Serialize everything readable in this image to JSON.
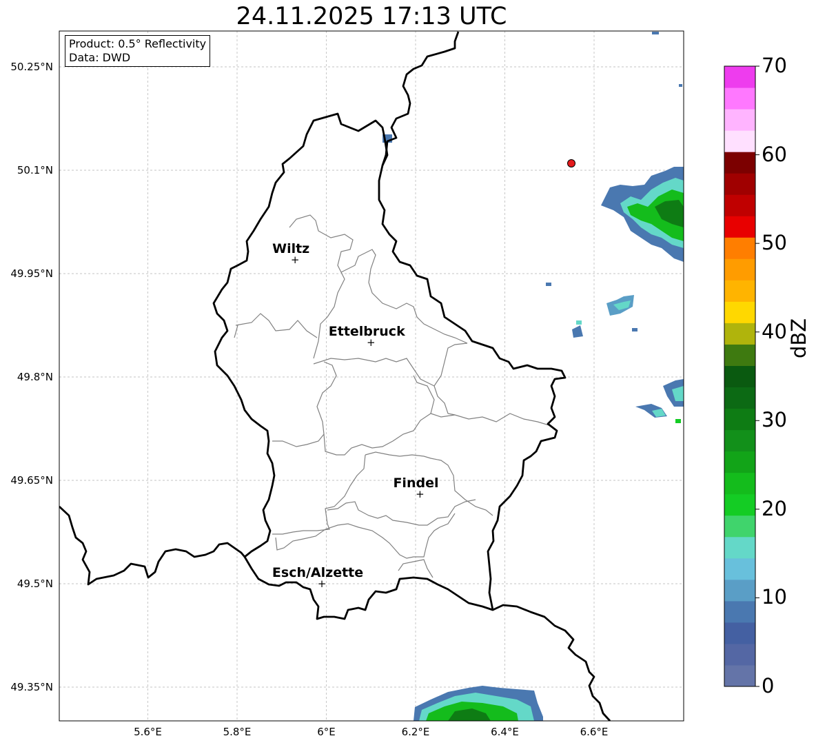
{
  "title": "24.11.2025 17:13 UTC",
  "info": {
    "product": "Product: 0.5° Reflectivity",
    "data_source": "Data: DWD"
  },
  "map": {
    "lon_range": [
      5.4,
      6.8
    ],
    "lat_range": [
      49.3,
      50.3
    ],
    "lon_ticks": [
      "5.6°E",
      "5.8°E",
      "6°E",
      "6.2°E",
      "6.4°E",
      "6.6°E"
    ],
    "lat_ticks": [
      "50.25°N",
      "50.1°N",
      "49.95°N",
      "49.8°N",
      "49.65°N",
      "49.5°N",
      "49.35°N"
    ],
    "gridlines": true,
    "cities": [
      {
        "name": "Wiltz",
        "lon": 5.93,
        "lat": 49.97
      },
      {
        "name": "Ettelbruck",
        "lon": 6.1,
        "lat": 49.85
      },
      {
        "name": "Findel",
        "lon": 6.21,
        "lat": 49.63
      },
      {
        "name": "Esch/Alzette",
        "lon": 5.99,
        "lat": 49.5
      }
    ],
    "radar_site_color": "#e41a1c"
  },
  "colorbar": {
    "label": "dBZ",
    "min": 0,
    "max": 70,
    "tick_labels": [
      "70",
      "60",
      "50",
      "40",
      "30",
      "20",
      "10",
      "0"
    ],
    "colors": [
      "#6474a8",
      "#5467a4",
      "#4460a2",
      "#4a78b0",
      "#5a9ec6",
      "#68c0dc",
      "#64d8c8",
      "#40d46c",
      "#14cc24",
      "#14bc1c",
      "#12a418",
      "#12901a",
      "#0e7c14",
      "#0c6a14",
      "#0a5a10",
      "#3e7a10",
      "#b0b40c",
      "#ffd800",
      "#ffb400",
      "#ff9c00",
      "#ff7e00",
      "#e80000",
      "#c00000",
      "#a00000",
      "#7c0000",
      "#ffe0ff",
      "#ffb4ff",
      "#ff78ff",
      "#ee3cee"
    ]
  }
}
